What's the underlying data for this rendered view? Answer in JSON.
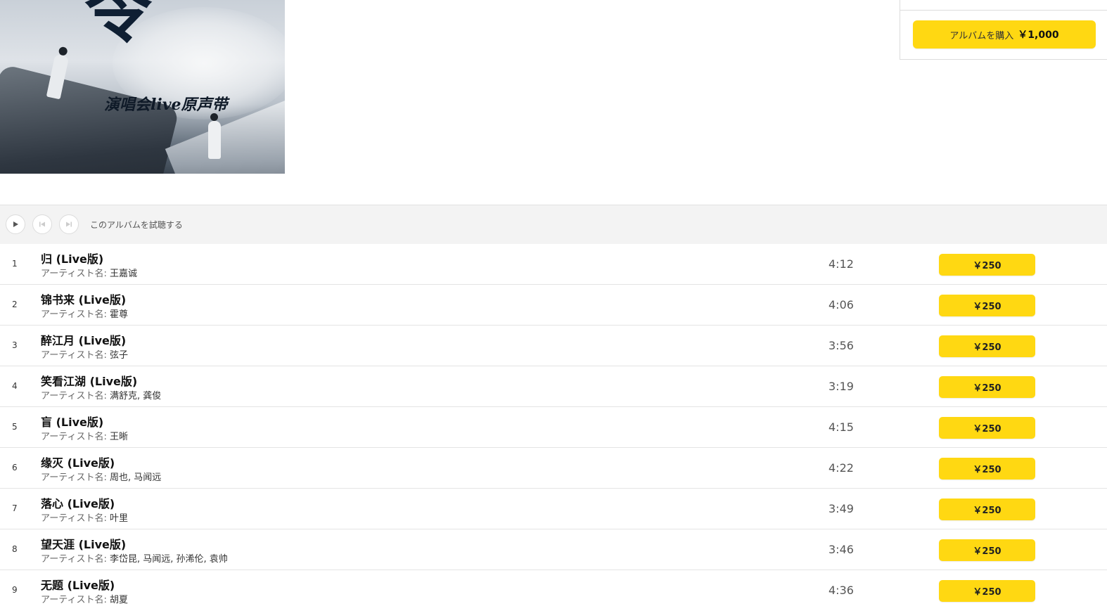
{
  "album": {
    "cover_title_glyph": "令",
    "cover_subtitle": "演唱会live原声带"
  },
  "buy": {
    "label": "アルバムを購入",
    "price": "￥1,000",
    "accent": "#ffd812"
  },
  "player": {
    "label": "このアルバムを試聴する",
    "icons": [
      "play-icon",
      "previous-track-icon",
      "next-track-icon"
    ]
  },
  "tracks": {
    "artist_prefix": "アーティスト名:",
    "items": [
      {
        "num": "1",
        "title": "归 (Live版)",
        "artists": "王嘉诚",
        "duration": "4:12",
        "price": "￥250"
      },
      {
        "num": "2",
        "title": "锦书来 (Live版)",
        "artists": "霍尊",
        "duration": "4:06",
        "price": "￥250"
      },
      {
        "num": "3",
        "title": "醉江月 (Live版)",
        "artists": "弦子",
        "duration": "3:56",
        "price": "￥250"
      },
      {
        "num": "4",
        "title": "笑看江湖 (Live版)",
        "artists": "满舒克, 龚俊",
        "duration": "3:19",
        "price": "￥250"
      },
      {
        "num": "5",
        "title": "盲 (Live版)",
        "artists": "王晰",
        "duration": "4:15",
        "price": "￥250"
      },
      {
        "num": "6",
        "title": "缘灭 (Live版)",
        "artists": "周也, 马闻远",
        "duration": "4:22",
        "price": "￥250"
      },
      {
        "num": "7",
        "title": "落心 (Live版)",
        "artists": "叶里",
        "duration": "3:49",
        "price": "￥250"
      },
      {
        "num": "8",
        "title": "望天涯 (Live版)",
        "artists": "李岱昆, 马闻远, 孙浠伦, 袁帅",
        "duration": "3:46",
        "price": "￥250"
      },
      {
        "num": "9",
        "title": "无题 (Live版)",
        "artists": "胡夏",
        "duration": "4:36",
        "price": "￥250"
      }
    ]
  }
}
